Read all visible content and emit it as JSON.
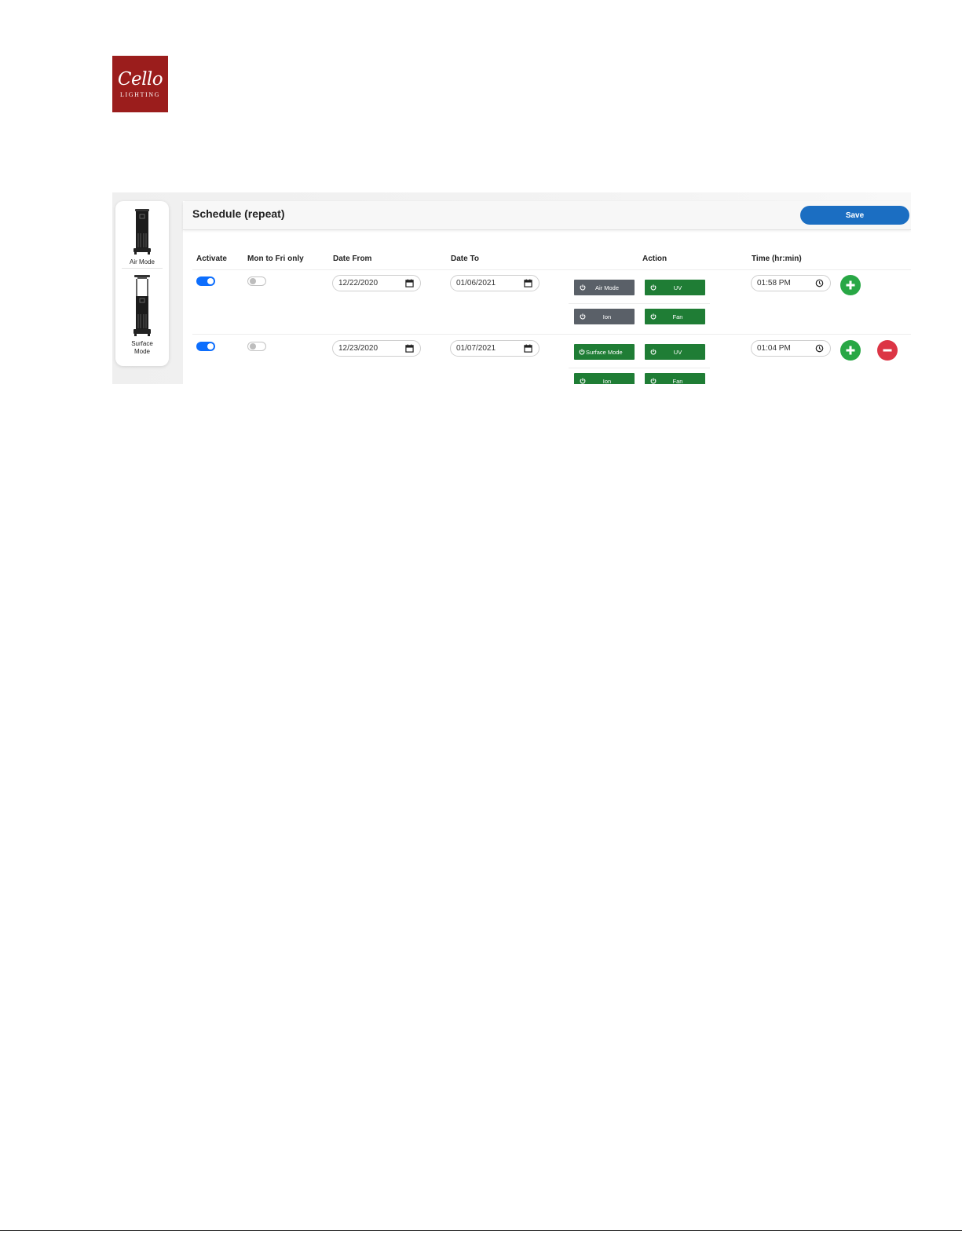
{
  "logo": {
    "word": "Cello",
    "sub": "LIGHTING"
  },
  "sidebar": {
    "modes": [
      {
        "label": "Air Mode"
      },
      {
        "label": "Surface Mode"
      }
    ]
  },
  "panel": {
    "title": "Schedule (repeat)",
    "save_label": "Save"
  },
  "columns": [
    "Activate",
    "Mon to Fri only",
    "Date From",
    "Date To",
    "Action",
    "Time (hr:min)"
  ],
  "rows": [
    {
      "activate": true,
      "mon_to_fri": false,
      "date_from": "12/22/2020",
      "date_to": "01/06/2021",
      "actions": [
        {
          "label": "Air Mode",
          "state": "off"
        },
        {
          "label": "UV",
          "state": "on"
        },
        {
          "label": "Ion",
          "state": "off"
        },
        {
          "label": "Fan",
          "state": "on"
        }
      ],
      "time": "01:58 PM"
    },
    {
      "activate": true,
      "mon_to_fri": false,
      "date_from": "12/23/2020",
      "date_to": "01/07/2021",
      "actions": [
        {
          "label": "Surface Mode",
          "state": "on"
        },
        {
          "label": "UV",
          "state": "on"
        },
        {
          "label": "Ion",
          "state": "on"
        },
        {
          "label": "Fan",
          "state": "on"
        }
      ],
      "time": "01:04 PM"
    }
  ],
  "colors": {
    "brand": "#9b1d1c",
    "primary": "#1b6ec2",
    "toggle_on": "#0d6efd",
    "action_on": "#1f7d35",
    "action_off": "#5a6068",
    "add": "#28a745",
    "remove": "#dc3545"
  },
  "icons": [
    "power-icon",
    "calendar-icon",
    "clock-icon",
    "plus-icon",
    "minus-icon"
  ]
}
